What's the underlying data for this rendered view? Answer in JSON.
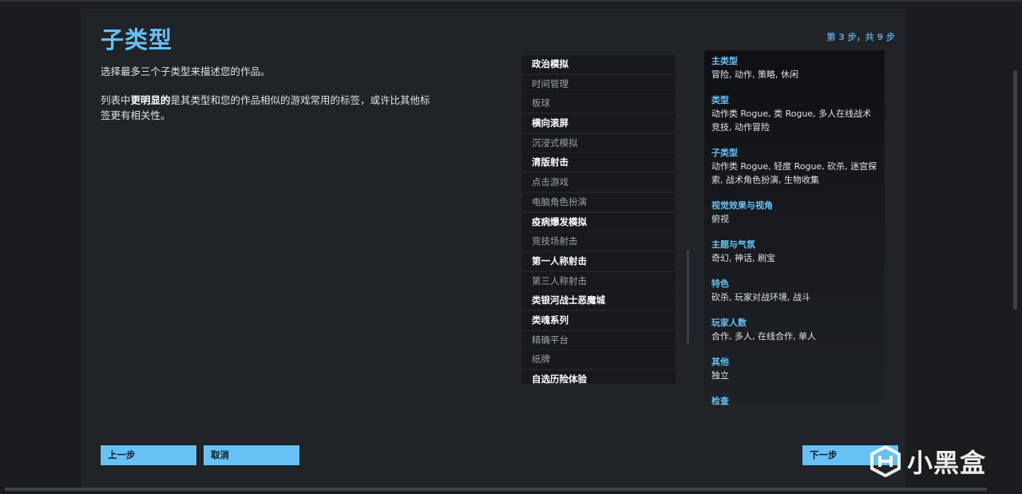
{
  "header": {
    "title": "子类型",
    "step": "第 3 步，共 9 步"
  },
  "description": {
    "line1": "选择最多三个子类型来描述您的作品。",
    "line2_prefix": "列表中",
    "line2_bold": "更明显的",
    "line2_suffix": "是其类型和您的作品相似的游戏常用的标签，或许比其他标签更有相关性。"
  },
  "subgenre_list": [
    {
      "label": "政治模拟",
      "emphasis": true
    },
    {
      "label": "时间管理",
      "emphasis": false
    },
    {
      "label": "板球",
      "emphasis": false
    },
    {
      "label": "横向滚屏",
      "emphasis": true
    },
    {
      "label": "沉浸式模拟",
      "emphasis": false
    },
    {
      "label": "清版射击",
      "emphasis": true
    },
    {
      "label": "点击游戏",
      "emphasis": false
    },
    {
      "label": "电脑角色扮演",
      "emphasis": false
    },
    {
      "label": "疫病爆发模拟",
      "emphasis": true
    },
    {
      "label": "竞技场射击",
      "emphasis": false
    },
    {
      "label": "第一人称射击",
      "emphasis": true
    },
    {
      "label": "第三人称射击",
      "emphasis": false
    },
    {
      "label": "类银河战士恶魔城",
      "emphasis": true
    },
    {
      "label": "类魂系列",
      "emphasis": true
    },
    {
      "label": "精确平台",
      "emphasis": false
    },
    {
      "label": "纸牌",
      "emphasis": false
    },
    {
      "label": "自选历险体验",
      "emphasis": true
    }
  ],
  "summary": [
    {
      "title": "主类型",
      "value": "冒险, 动作, 策略, 休闲"
    },
    {
      "title": "类型",
      "value": "动作类 Rogue, 类 Rogue, 多人在线战术竞技, 动作冒险"
    },
    {
      "title": "子类型",
      "value": "动作类 Rogue, 轻度 Rogue, 砍杀, 迷宫探索, 战术角色扮演, 生物收集"
    },
    {
      "title": "视觉效果与视角",
      "value": "俯视"
    },
    {
      "title": "主题与气氛",
      "value": "奇幻, 神话, 刷宝"
    },
    {
      "title": "特色",
      "value": "砍杀, 玩家对战环境, 战斗"
    },
    {
      "title": "玩家人数",
      "value": "合作, 多人, 在线合作, 单人"
    },
    {
      "title": "其他",
      "value": "独立"
    },
    {
      "title": "检查",
      "value": ""
    }
  ],
  "buttons": {
    "back": "上一步",
    "cancel": "取消",
    "next": "下一步"
  },
  "watermark": {
    "text": "小黑盒"
  },
  "colors": {
    "accent": "#66c0f4",
    "button": "#67c1f5",
    "panel": "#202327"
  }
}
